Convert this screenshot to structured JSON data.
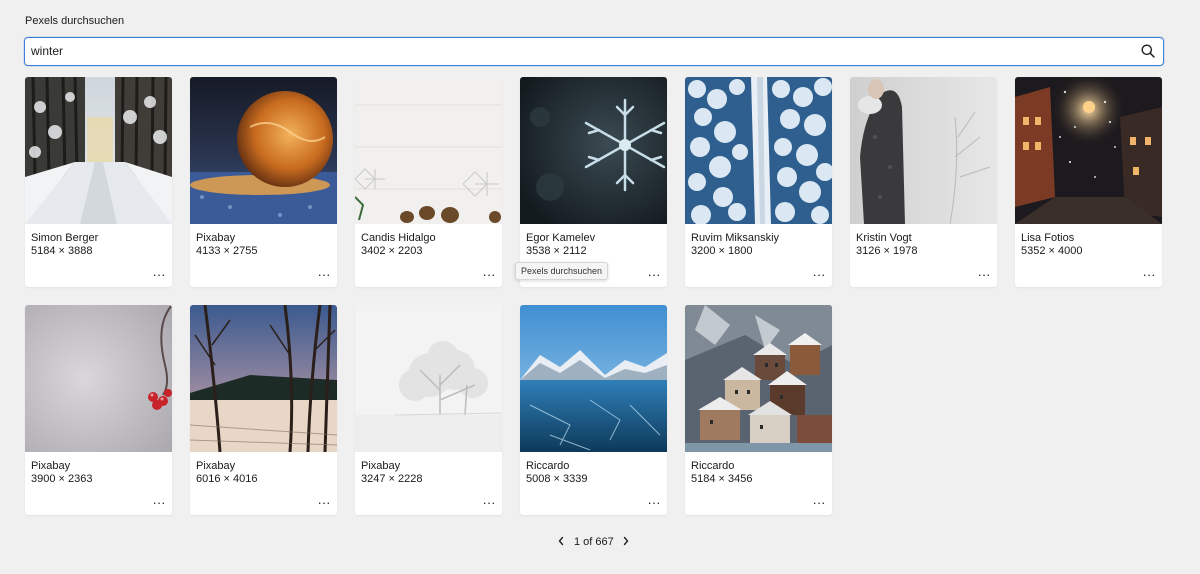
{
  "page": {
    "title": "Pexels durchsuchen"
  },
  "search": {
    "value": "winter",
    "placeholder": ""
  },
  "results": [
    {
      "author": "Simon Berger",
      "dims": "5184 × 3888",
      "scene": "snowy-forest-road"
    },
    {
      "author": "Pixabay",
      "dims": "4133 × 2755",
      "scene": "frozen-bubble"
    },
    {
      "author": "Candis Hidalgo",
      "dims": "3402 × 2203",
      "scene": "white-wood-pinecones"
    },
    {
      "author": "Egor Kamelev",
      "dims": "3538 × 2112",
      "scene": "snowflake-macro"
    },
    {
      "author": "Ruvim Miksanskiy",
      "dims": "3200 × 1800",
      "scene": "aerial-snow-forest"
    },
    {
      "author": "Kristin Vogt",
      "dims": "3126 × 1978",
      "scene": "person-in-snow"
    },
    {
      "author": "Lisa Fotios",
      "dims": "5352 × 4000",
      "scene": "night-town-snow"
    },
    {
      "author": "Pixabay",
      "dims": "3900 × 2363",
      "scene": "red-berries-frost"
    },
    {
      "author": "Pixabay",
      "dims": "6016 × 4016",
      "scene": "sunset-birches"
    },
    {
      "author": "Pixabay",
      "dims": "3247 × 2228",
      "scene": "white-tree-fog"
    },
    {
      "author": "Riccardo",
      "dims": "5008 × 3339",
      "scene": "frozen-lake-mountains"
    },
    {
      "author": "Riccardo",
      "dims": "5184 × 3456",
      "scene": "hallstatt-village"
    }
  ],
  "more_label": "···",
  "tooltip": "Pexels durchsuchen",
  "pagination": {
    "text": "1 of 667"
  },
  "icons": {
    "search": "search-icon",
    "prev": "chevron-left-icon",
    "next": "chevron-right-icon"
  },
  "colors": {
    "accent": "#3d7fd9",
    "background": "#f0f0f0"
  }
}
